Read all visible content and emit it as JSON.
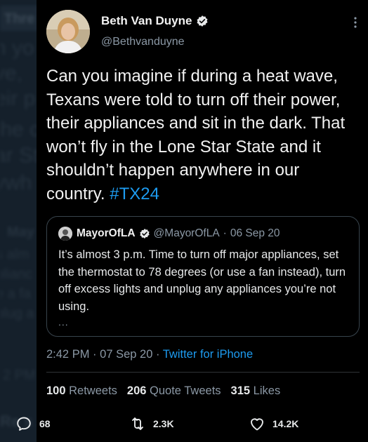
{
  "background": {
    "header_fragment": "Thre",
    "lines": [
      "n yo",
      "ve, ",
      "eir p",
      "the c",
      "ar St",
      "ywh"
    ],
    "mid_name": "May",
    "mid_lines": [
      "s alm",
      "plianc",
      "e a fa",
      "plug a"
    ],
    "time_fragment": "2 PM",
    "stats_fragment": "Re s  206 Qu  eets  315"
  },
  "tweet": {
    "author_name": "Beth Van Duyne",
    "author_handle": "@Bethvanduyne",
    "text_main": "Can you imagine if during a heat wave, Texans were told to turn off their power, their appliances and sit in the dark. That won’t fly in the Lone Star State and it shouldn’t happen anywhere in our country.",
    "hashtag": "#TX24",
    "time": "2:42 PM",
    "date": "07 Sep 20",
    "source": "Twitter for iPhone",
    "sep": "·"
  },
  "quote": {
    "name": "MayorOfLA",
    "handle": "@MayorOfLA",
    "date": "06 Sep 20",
    "text": "It’s almost 3 p.m. Time to turn off major appliances, set the thermostat to 78 degrees (or use a fan instead), turn off excess lights and unplug any appliances you’re not using.",
    "ellipsis": "...",
    "sep": "·"
  },
  "stats": {
    "retweets_count": "100",
    "retweets_label": "Retweets",
    "quotes_count": "206",
    "quotes_label": "Quote Tweets",
    "likes_count": "315",
    "likes_label": "Likes"
  },
  "actions": {
    "replies": "68",
    "retweets": "2.3K",
    "likes": "14.2K"
  },
  "colors": {
    "accent": "#1d9bf0",
    "background": "#15202b",
    "card": "#000000"
  }
}
